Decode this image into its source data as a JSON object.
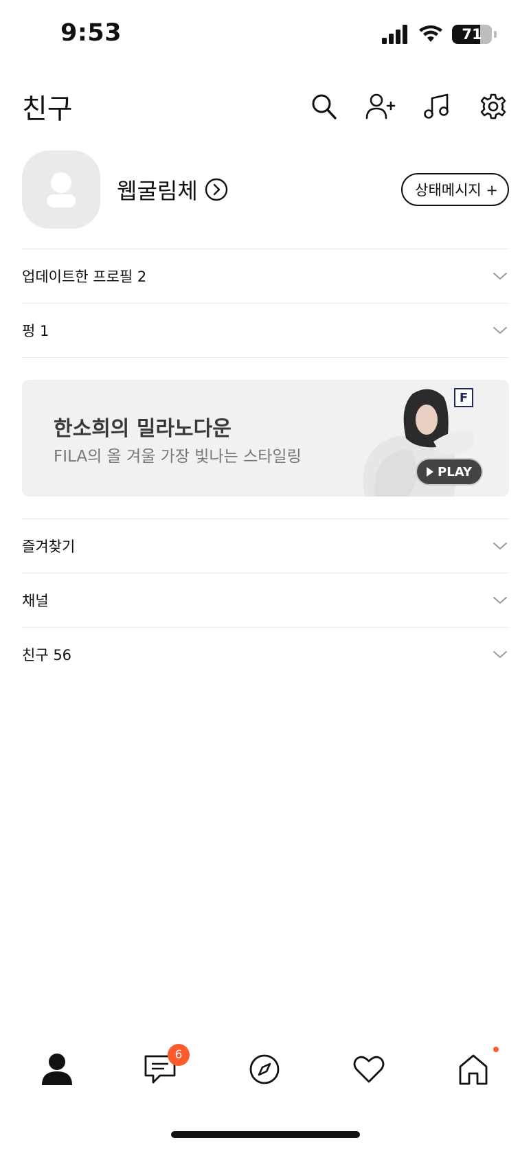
{
  "status_bar": {
    "time": "9:53",
    "battery_level": 71,
    "battery_text": "71",
    "icons": [
      "cellular-signal-icon",
      "wifi-icon",
      "battery-icon"
    ]
  },
  "header": {
    "title": "친구",
    "actions": [
      "search-icon",
      "add-friend-icon",
      "music-icon",
      "settings-icon"
    ]
  },
  "profile": {
    "name": "웹굴림체",
    "status_message_button": "상태메시지 +"
  },
  "sections": {
    "updated_profiles": "업데이트한 프로필 2",
    "pung": "펑 1",
    "favorites": "즐겨찾기",
    "channels": "채널",
    "friends": "친구 56"
  },
  "ad": {
    "title": "한소희의 밀라노다운",
    "subtitle": "FILA의 올 겨울 가장 빛나는 스타일링",
    "logo_text": "F",
    "play_label": "PLAY"
  },
  "tab_bar": {
    "tabs": [
      "person-icon",
      "chat-icon",
      "compass-icon",
      "heart-icon",
      "home-icon"
    ],
    "chat_badge": "6"
  },
  "colors": {
    "accent": "#ff5a2c",
    "avatar_bg": "#eaeaea",
    "banner_bg": "#f1f1f1"
  }
}
